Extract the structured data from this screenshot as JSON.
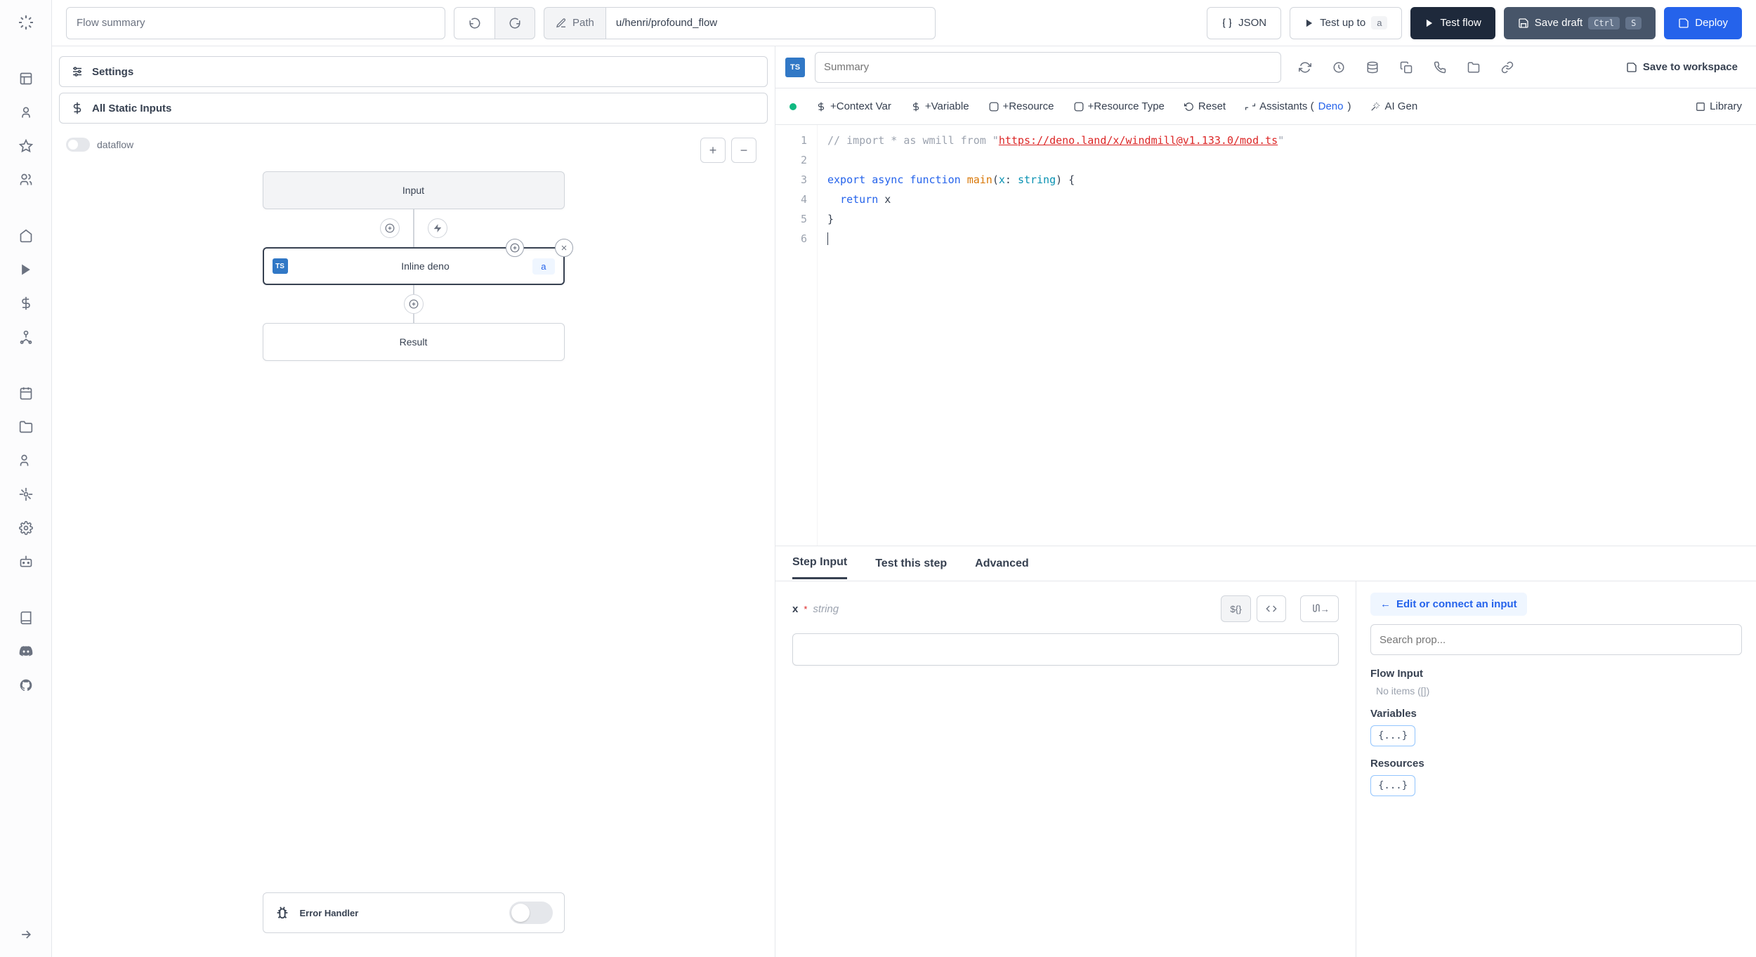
{
  "topbar": {
    "summary_placeholder": "Flow summary",
    "path_label": "Path",
    "path_value": "u/henri/profound_flow",
    "json_btn": "JSON",
    "test_up_to": "Test up to",
    "test_up_to_badge": "a",
    "test_flow": "Test flow",
    "save_draft": "Save draft",
    "save_kbd1": "Ctrl",
    "save_kbd2": "S",
    "deploy": "Deploy"
  },
  "flow_panel": {
    "settings": "Settings",
    "static_inputs": "All Static Inputs",
    "dataflow": "dataflow",
    "node_input": "Input",
    "node_step": "Inline deno",
    "node_step_badge": "a",
    "node_result": "Result",
    "error_handler": "Error Handler"
  },
  "editor_header": {
    "summary_placeholder": "Summary",
    "save_to_workspace": "Save to workspace"
  },
  "toolbar": {
    "context_var": "+Context Var",
    "variable": "+Variable",
    "resource": "+Resource",
    "resource_type": "+Resource Type",
    "reset": "Reset",
    "assistants_pre": "Assistants (",
    "assistants_link": "Deno",
    "assistants_post": ")",
    "ai_gen": "AI Gen",
    "library": "Library"
  },
  "code": {
    "l1_a": "// import * as wmill from \"",
    "l1_b": "https://deno.land/x/windmill@v1.133.0/mod.ts",
    "l1_c": "\"",
    "l3_export": "export",
    "l3_async": "async",
    "l3_function": "function",
    "l3_main": "main",
    "l3_paren_open": "(",
    "l3_x": "x",
    "l3_colon": ": ",
    "l3_string": "string",
    "l3_paren_close": ") {",
    "l4_return": "return",
    "l4_x": " x",
    "l5": "}",
    "gutter": [
      "1",
      "2",
      "3",
      "4",
      "5",
      "6"
    ]
  },
  "tabs": {
    "step_input": "Step Input",
    "test_step": "Test this step",
    "advanced": "Advanced"
  },
  "step_input": {
    "name": "x",
    "req": "*",
    "type": "string",
    "expr_btn": "${}"
  },
  "connect": {
    "edit": "Edit or connect an input",
    "search_placeholder": "Search prop...",
    "flow_input_hdr": "Flow Input",
    "no_items": "No items ([])",
    "variables_hdr": "Variables",
    "resources_hdr": "Resources",
    "obj_chip": "{...}"
  }
}
